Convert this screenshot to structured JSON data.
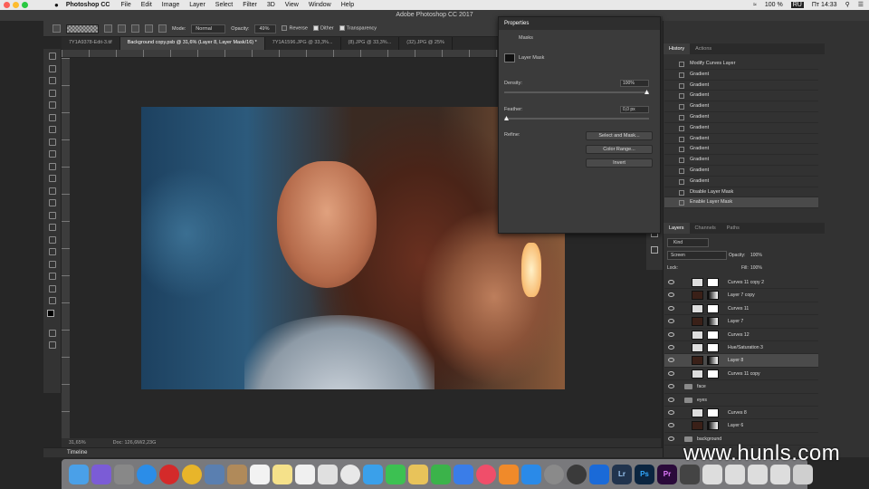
{
  "menubar": {
    "app": "Photoshop CC",
    "items": [
      "File",
      "Edit",
      "Image",
      "Layer",
      "Select",
      "Filter",
      "3D",
      "View",
      "Window",
      "Help"
    ],
    "battery": "100 %",
    "lang": "RU",
    "time": "Пт 14:33"
  },
  "titlebar": {
    "title": "Adobe Photoshop CC 2017"
  },
  "options": {
    "mode_label": "Mode:",
    "mode_value": "Normal",
    "opacity_label": "Opacity:",
    "opacity_value": "49%",
    "reverse": "Reverse",
    "dither": "Dither",
    "transparency": "Transparency"
  },
  "tabs": [
    "7Y1A9378-Edit-3.tif",
    "Background copy.psb @ 31,6% (Layer 8, Layer Mask/16) *",
    "7Y1A1596.JPG @ 33,3%...",
    "(8).JPG @ 33,3%...",
    "(32).JPG @ 25%"
  ],
  "status": {
    "zoom": "31,65%",
    "doc": "Doc: 126,6M/2,23G"
  },
  "timeline": "Timeline",
  "properties": {
    "title": "Properties",
    "section": "Masks",
    "mask_label": "Layer Mask",
    "density_label": "Density:",
    "density_value": "100%",
    "feather_label": "Feather:",
    "feather_value": "0,0 px",
    "refine_label": "Refine:",
    "btn_select": "Select and Mask...",
    "btn_color": "Color Range...",
    "btn_invert": "Invert",
    "density_level": 1.0,
    "feather_level": 0.0
  },
  "history": {
    "tabs": [
      "History",
      "Actions"
    ],
    "items": [
      "Modify Curves Layer",
      "Gradient",
      "Gradient",
      "Gradient",
      "Gradient",
      "Gradient",
      "Gradient",
      "Gradient",
      "Gradient",
      "Gradient",
      "Gradient",
      "Gradient",
      "Disable Layer Mask",
      "Enable Layer Mask"
    ]
  },
  "layers": {
    "tabs": [
      "Layers",
      "Channels",
      "Paths"
    ],
    "kind": "Kind",
    "blend": "Screen",
    "opacity_label": "Opacity:",
    "opacity_value": "100%",
    "lock_label": "Lock:",
    "fill_label": "Fill:",
    "fill_value": "100%",
    "items": [
      "Curves 11 copy 2",
      "Layer 7 copy",
      "Curves 11",
      "Layer 7",
      "Curves 12",
      "Hue/Saturation 3",
      "Layer 8",
      "Curves 11 copy",
      "face",
      "eyes",
      "Curves 8",
      "Layer 6",
      "background"
    ]
  },
  "watermark": "www.hunls.com",
  "dock_labels": {
    "lr": "Lr",
    "ps": "Ps",
    "pr": "Pr"
  }
}
